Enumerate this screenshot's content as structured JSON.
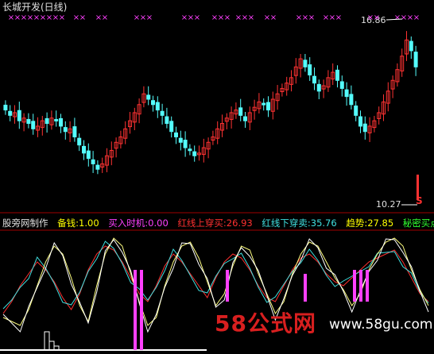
{
  "window": {
    "title": "长城开发(日线)",
    "high_label": "16.86",
    "low_label": "10.27",
    "sell_signal": "S"
  },
  "indicator_bar": {
    "name": "股旁网制作",
    "items": [
      {
        "text": "备钱:1.00",
        "color": "#ffff00"
      },
      {
        "text": "买入时机:0.00",
        "color": "#ff40ff"
      },
      {
        "text": "红线上穿买:26.93",
        "color": "#ff3030"
      },
      {
        "text": "红线下穿卖:35.76",
        "color": "#40e0e0"
      },
      {
        "text": "趋势:27.85",
        "color": "#ffff00"
      },
      {
        "text": "秘密买点:(",
        "color": "#30ff30"
      }
    ]
  },
  "watermark": {
    "text": "58公式网",
    "url": "www.58gu.com"
  },
  "colors": {
    "bg": "#000000",
    "up": "#ff3232",
    "down": "#54fcfc",
    "marker": "#ff40ff",
    "red_line": "#ff3030",
    "cyan_line": "#40e0e0",
    "yellow_line": "#ffff80",
    "white_line": "#ffffff",
    "divider": "#a00000"
  },
  "chart_data": {
    "type": "candlestick",
    "price_scale": {
      "max": 16.86,
      "min": 10.27
    },
    "candles_note": "approximate closing path",
    "closes": [
      14.0,
      13.8,
      13.9,
      13.6,
      13.7,
      13.5,
      13.3,
      13.4,
      13.6,
      13.5,
      13.7,
      13.6,
      13.4,
      13.2,
      13.3,
      13.0,
      12.7,
      12.4,
      12.2,
      12.0,
      11.8,
      12.0,
      12.3,
      12.5,
      12.8,
      13.0,
      13.3,
      13.6,
      13.9,
      14.2,
      14.6,
      14.4,
      14.2,
      14.0,
      13.8,
      13.5,
      13.2,
      13.0,
      12.8,
      12.6,
      12.5,
      12.3,
      12.4,
      12.6,
      12.8,
      13.0,
      13.3,
      13.5,
      13.7,
      13.9,
      14.0,
      13.8,
      13.6,
      13.9,
      14.1,
      14.3,
      14.2,
      14.0,
      14.4,
      14.6,
      14.8,
      15.0,
      15.2,
      15.6,
      15.9,
      15.6,
      15.3,
      15.0,
      14.7,
      14.9,
      15.2,
      15.4,
      15.1,
      14.8,
      14.5,
      14.2,
      13.8,
      13.4,
      13.2,
      13.4,
      13.6,
      13.9,
      14.3,
      14.7,
      15.1,
      15.5,
      16.0,
      16.6,
      16.2,
      15.6
    ]
  }
}
